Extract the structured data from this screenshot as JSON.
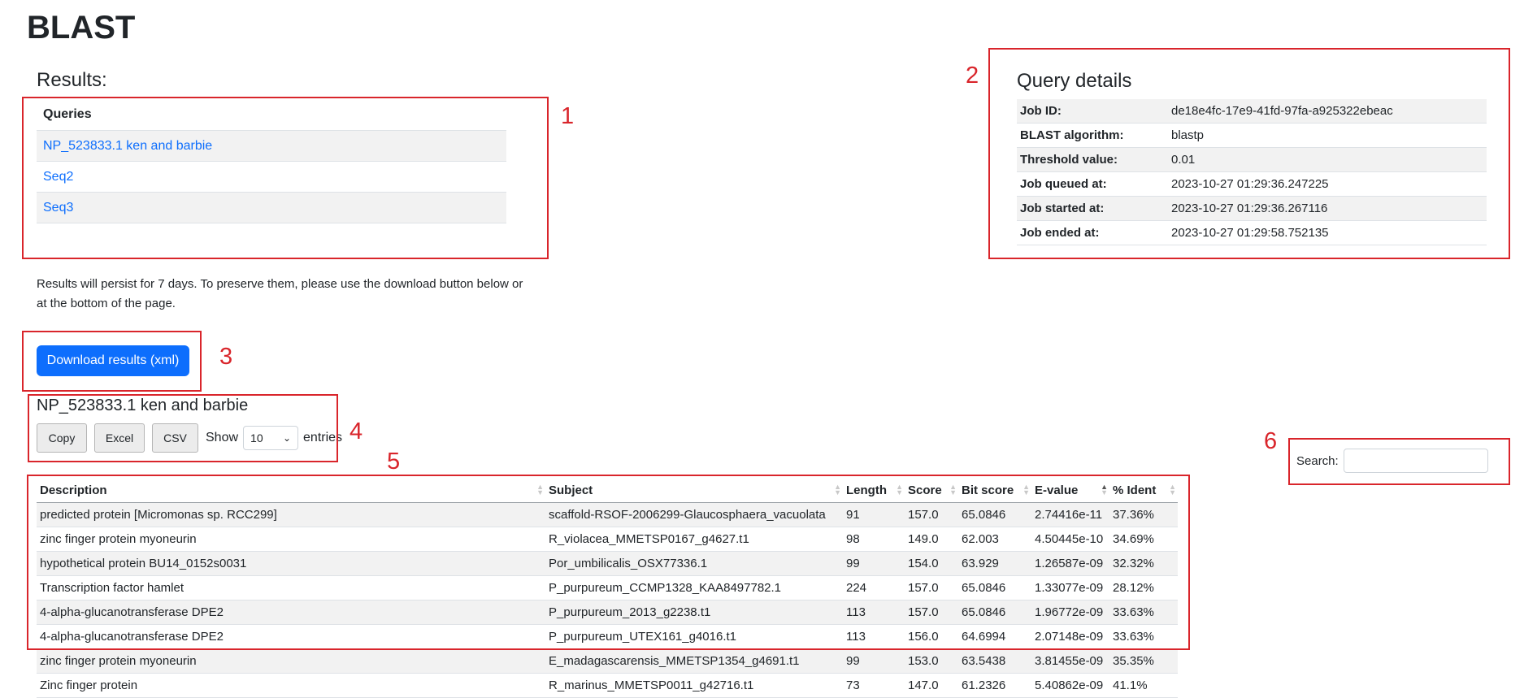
{
  "page_title": "BLAST",
  "results_heading": "Results:",
  "queries": {
    "header": "Queries",
    "items": [
      "NP_523833.1 ken and barbie",
      "Seq2",
      "Seq3"
    ]
  },
  "persist_note": "Results will persist for 7 days. To preserve them, please use the download button below or at the bottom of the page.",
  "download_button": "Download results (xml)",
  "query_details": {
    "title": "Query details",
    "rows": [
      {
        "key": "Job ID:",
        "value": "de18e4fc-17e9-41fd-97fa-a925322ebeac"
      },
      {
        "key": "BLAST algorithm:",
        "value": "blastp"
      },
      {
        "key": "Threshold value:",
        "value": "0.01"
      },
      {
        "key": "Job queued at:",
        "value": "2023-10-27 01:29:36.247225"
      },
      {
        "key": "Job started at:",
        "value": "2023-10-27 01:29:36.267116"
      },
      {
        "key": "Job ended at:",
        "value": "2023-10-27 01:29:58.752135"
      }
    ]
  },
  "sequence_title": "NP_523833.1 ken and barbie",
  "toolbar": {
    "copy": "Copy",
    "excel": "Excel",
    "csv": "CSV",
    "show": "Show",
    "entries_value": "10",
    "entries": "entries"
  },
  "search": {
    "label": "Search:",
    "value": ""
  },
  "annotations": [
    "1",
    "2",
    "3",
    "4",
    "5",
    "6"
  ],
  "results_table": {
    "columns": [
      "Description",
      "Subject",
      "Length",
      "Score",
      "Bit score",
      "E-value",
      "% Ident"
    ],
    "rows": [
      [
        "predicted protein [Micromonas sp. RCC299]",
        "scaffold-RSOF-2006299-Glaucosphaera_vacuolata",
        "91",
        "157.0",
        "65.0846",
        "2.74416e-11",
        "37.36%"
      ],
      [
        "zinc finger protein myoneurin",
        "R_violacea_MMETSP0167_g4627.t1",
        "98",
        "149.0",
        "62.003",
        "4.50445e-10",
        "34.69%"
      ],
      [
        "hypothetical protein BU14_0152s0031",
        "Por_umbilicalis_OSX77336.1",
        "99",
        "154.0",
        "63.929",
        "1.26587e-09",
        "32.32%"
      ],
      [
        "Transcription factor hamlet",
        "P_purpureum_CCMP1328_KAA8497782.1",
        "224",
        "157.0",
        "65.0846",
        "1.33077e-09",
        "28.12%"
      ],
      [
        "4-alpha-glucanotransferase DPE2",
        "P_purpureum_2013_g2238.t1",
        "113",
        "157.0",
        "65.0846",
        "1.96772e-09",
        "33.63%"
      ],
      [
        "4-alpha-glucanotransferase DPE2",
        "P_purpureum_UTEX161_g4016.t1",
        "113",
        "156.0",
        "64.6994",
        "2.07148e-09",
        "33.63%"
      ],
      [
        "zinc finger protein myoneurin",
        "E_madagascarensis_MMETSP1354_g4691.t1",
        "99",
        "153.0",
        "63.5438",
        "3.81455e-09",
        "35.35%"
      ],
      [
        "Zinc finger protein",
        "R_marinus_MMETSP0011_g42716.t1",
        "73",
        "147.0",
        "61.2326",
        "5.40862e-09",
        "41.1%"
      ]
    ]
  }
}
